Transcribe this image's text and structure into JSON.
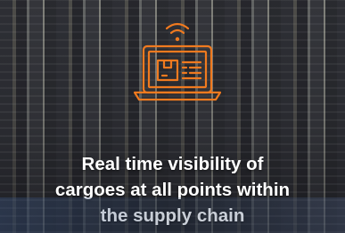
{
  "hero": {
    "icon_name": "laptop-cargo-tracking-icon",
    "accent_color": "#f07a1f",
    "caption_line1": "Real time visibility of",
    "caption_line2": "cargoes at all points within",
    "caption_line3": "the supply chain"
  }
}
